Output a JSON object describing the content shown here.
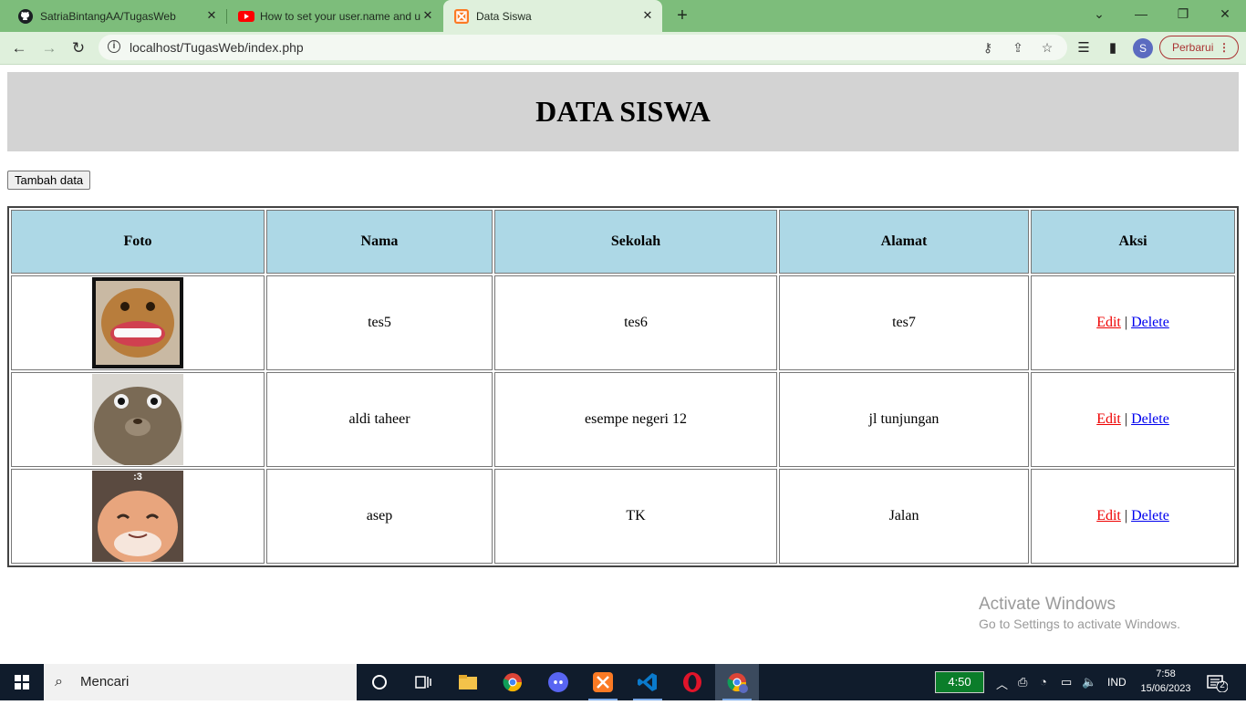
{
  "browser": {
    "tabs": [
      {
        "title": "SatriaBintangAA/TugasWeb",
        "icon": "github-icon"
      },
      {
        "title": "How to set your user.name and u",
        "icon": "youtube-icon"
      },
      {
        "title": "Data Siswa",
        "icon": "xampp-icon",
        "active": true
      }
    ],
    "url": "localhost/TugasWeb/index.php",
    "profile_initial": "S",
    "update_label": "Perbarui"
  },
  "page": {
    "title": "DATA SISWA",
    "add_button": "Tambah data",
    "table": {
      "headers": [
        "Foto",
        "Nama",
        "Sekolah",
        "Alamat",
        "Aksi"
      ],
      "rows": [
        {
          "nama": "tes5",
          "sekolah": "tes6",
          "alamat": "tes7",
          "photo": "grinning-monkey"
        },
        {
          "nama": "aldi taheer",
          "sekolah": "esempe negeri 12",
          "alamat": "jl tunjungan",
          "photo": "staring-cat"
        },
        {
          "nama": "asep",
          "sekolah": "TK",
          "alamat": "Jalan",
          "photo": "smiling-cat"
        }
      ],
      "edit_label": "Edit",
      "separator": "|",
      "delete_label": "Delete"
    },
    "photo_caption_row3": ":3"
  },
  "watermark": {
    "line1": "Activate Windows",
    "line2": "Go to Settings to activate Windows."
  },
  "taskbar": {
    "search_text": "Mencari",
    "battery_time": "4:50",
    "language": "IND",
    "time": "7:58",
    "date": "15/06/2023",
    "notification_count": "2"
  },
  "colors": {
    "tab_bar": "#7dbd7b",
    "toolbar": "#dff0dc",
    "header_bg": "#d3d3d3",
    "table_header_bg": "#add8e6",
    "edit_link": "#ee0000",
    "delete_link": "#0000ee",
    "taskbar": "#101c2c"
  }
}
